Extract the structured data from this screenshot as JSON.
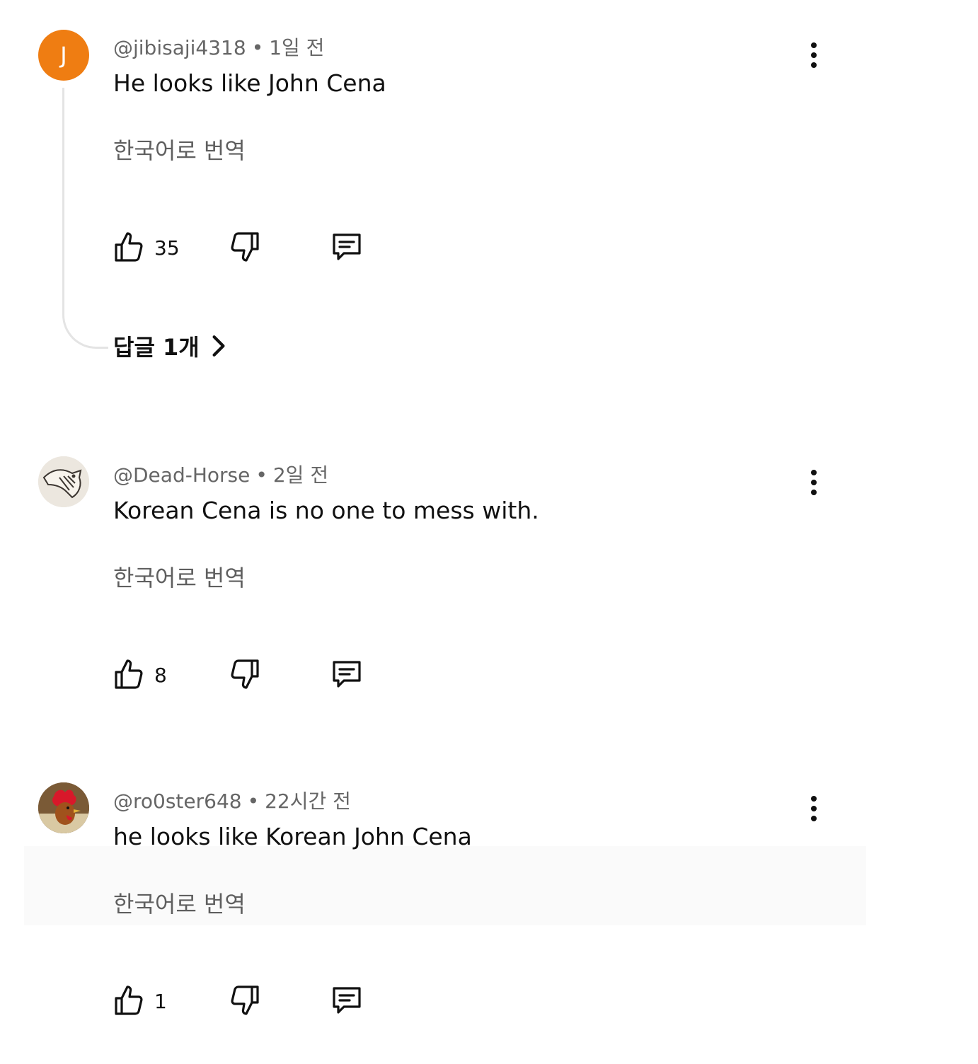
{
  "comments": [
    {
      "avatar_letter": "J",
      "handle": "@jibisaji4318",
      "time": "1일 전",
      "text": "He looks like John Cena",
      "translate": "한국어로 번역",
      "likes": "35",
      "replies": "답글 1개"
    },
    {
      "handle": "@Dead-Horse",
      "time": "2일 전",
      "text": "Korean Cena is no one to mess with.",
      "translate": "한국어로 번역",
      "likes": "8"
    },
    {
      "handle": "@ro0ster648",
      "time": "22시간 전",
      "text": "he looks like Korean John Cena",
      "translate": "한국어로 번역",
      "likes": "1"
    }
  ],
  "separator": "•",
  "colors": {
    "avatar_orange": "#ef7d12",
    "meta_gray": "#666666"
  }
}
